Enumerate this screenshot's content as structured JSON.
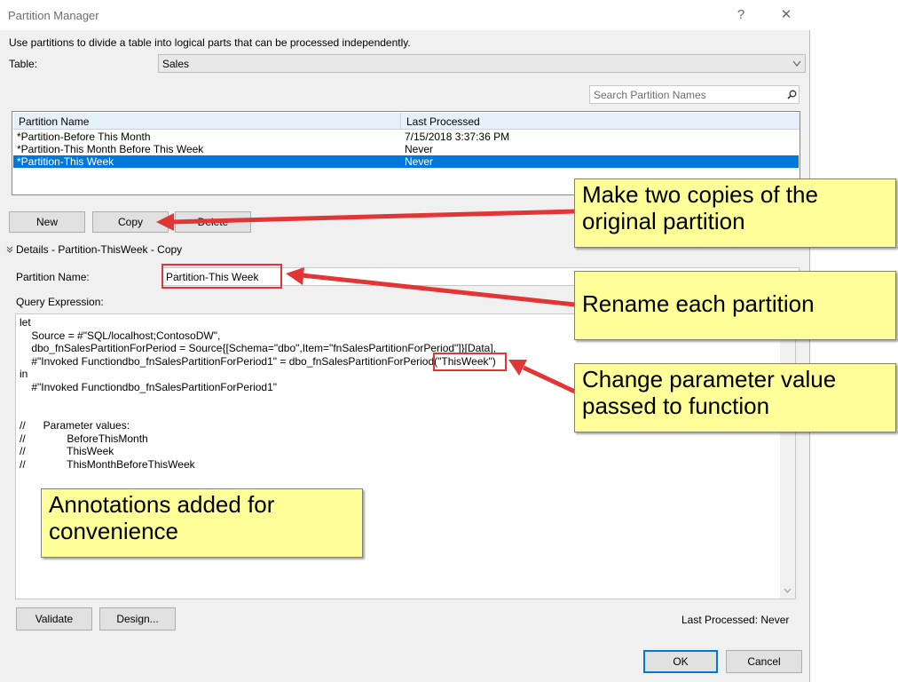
{
  "window": {
    "title": "Partition Manager",
    "help_glyph": "?",
    "close_glyph": "✕"
  },
  "intro": "Use partitions to divide a table into logical parts that can be processed independently.",
  "table": {
    "label": "Table:",
    "value": "Sales"
  },
  "search": {
    "placeholder": "Search Partition Names"
  },
  "grid": {
    "columns": [
      "Partition Name",
      "Last Processed"
    ],
    "rows": [
      {
        "name": "*Partition-Before This Month",
        "last": "7/15/2018 3:37:36 PM"
      },
      {
        "name": "*Partition-This Month Before This Week",
        "last": "Never"
      },
      {
        "name": "*Partition-This Week",
        "last": "Never"
      }
    ]
  },
  "buttons": {
    "new": "New",
    "copy": "Copy",
    "delete": "Delete",
    "validate": "Validate",
    "design": "Design...",
    "ok": "OK",
    "cancel": "Cancel"
  },
  "details": {
    "header": "Details - Partition-ThisWeek - Copy",
    "name_label": "Partition Name:",
    "name_value": "Partition-This Week",
    "query_label": "Query Expression:"
  },
  "query_lines": [
    "let",
    "    Source = #\"SQL/localhost;ContosoDW\",",
    "    dbo_fnSalesPartitionForPeriod = Source{[Schema=\"dbo\",Item=\"fnSalesPartitionForPeriod\"]}[Data],",
    "    #\"Invoked Functiondbo_fnSalesPartitionForPeriod1\" = dbo_fnSalesPartitionForPeriod(\"ThisWeek\")",
    "in",
    "    #\"Invoked Functiondbo_fnSalesPartitionForPeriod1\"",
    "",
    "",
    "//      Parameter values:",
    "//              BeforeThisMonth",
    "//              ThisWeek",
    "//              ThisMonthBeforeThisWeek"
  ],
  "status": "Last Processed: Never",
  "callouts": {
    "copies": "Make two copies of the original partition",
    "rename": "Rename each partition",
    "param": "Change parameter value passed to function",
    "note": "Annotations added for convenience"
  },
  "colors": {
    "selection": "#0078d7",
    "callout_fill": "#ffff99",
    "arrow": "#e23636"
  }
}
